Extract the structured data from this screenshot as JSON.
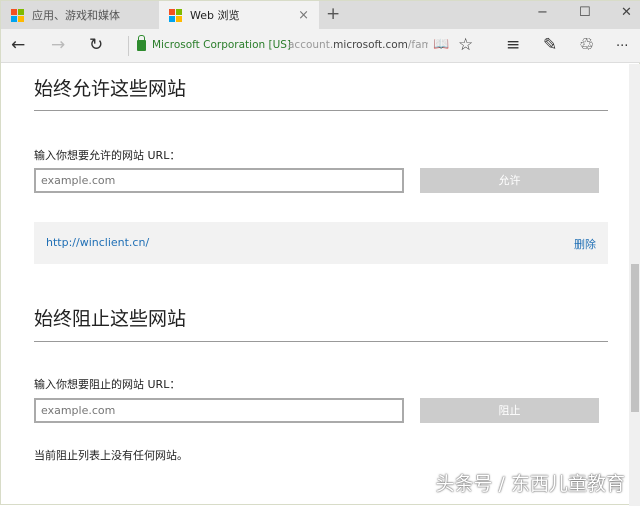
{
  "tabs": [
    {
      "label": "应用、游戏和媒体"
    },
    {
      "label": "Web 浏览",
      "close": "×"
    }
  ],
  "new_tab": "+",
  "window": {
    "minimize": "−",
    "maximize": "☐",
    "close": "✕"
  },
  "nav": {
    "back": "←",
    "forward": "→",
    "refresh": "↻",
    "identity": "Microsoft Corporation [US]",
    "url_pre": "account.",
    "url_domain": "microsoft.com",
    "url_post": "/family",
    "reading": "📖",
    "favorite": "☆",
    "hub": "≡",
    "note": "✎",
    "share": "♲",
    "more": "···"
  },
  "allow": {
    "title": "始终允许这些网站",
    "label": "输入你想要允许的网站 URL：",
    "placeholder": "example.com",
    "button": "允许",
    "items": [
      {
        "url": "http://winclient.cn/",
        "delete": "删除"
      }
    ]
  },
  "block": {
    "title": "始终阻止这些网站",
    "label": "输入你想要阻止的网站 URL：",
    "placeholder": "example.com",
    "button": "阻止",
    "empty": "当前阻止列表上没有任何网站。"
  },
  "watermark": "头条号 / 东西儿童教育"
}
